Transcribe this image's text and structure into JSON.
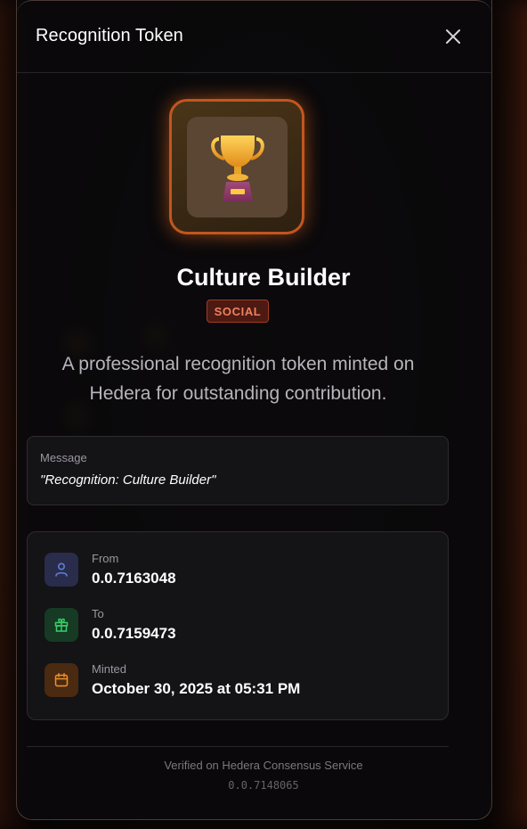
{
  "modal": {
    "title": "Recognition Token"
  },
  "token": {
    "name": "Culture Builder",
    "category": "SOCIAL",
    "description": "A professional recognition token minted on Hedera for outstanding contribution.",
    "icon": "trophy-icon"
  },
  "message": {
    "label": "Message",
    "text": "\"Recognition: Culture Builder\""
  },
  "details": {
    "from": {
      "label": "From",
      "value": "0.0.7163048",
      "icon": "user-icon",
      "color": "#5a7fd6"
    },
    "to": {
      "label": "To",
      "value": "0.0.7159473",
      "icon": "gift-icon",
      "color": "#3ad06a"
    },
    "minted": {
      "label": "Minted",
      "value": "October 30, 2025 at 05:31 PM",
      "icon": "calendar-icon",
      "color": "#f0922a"
    }
  },
  "footer": {
    "verified_text": "Verified on Hedera Consensus Service",
    "topic_id": "0.0.7148065"
  },
  "colors": {
    "accent": "#c2561f",
    "category_text": "#f08060",
    "background": "#0b0706"
  }
}
